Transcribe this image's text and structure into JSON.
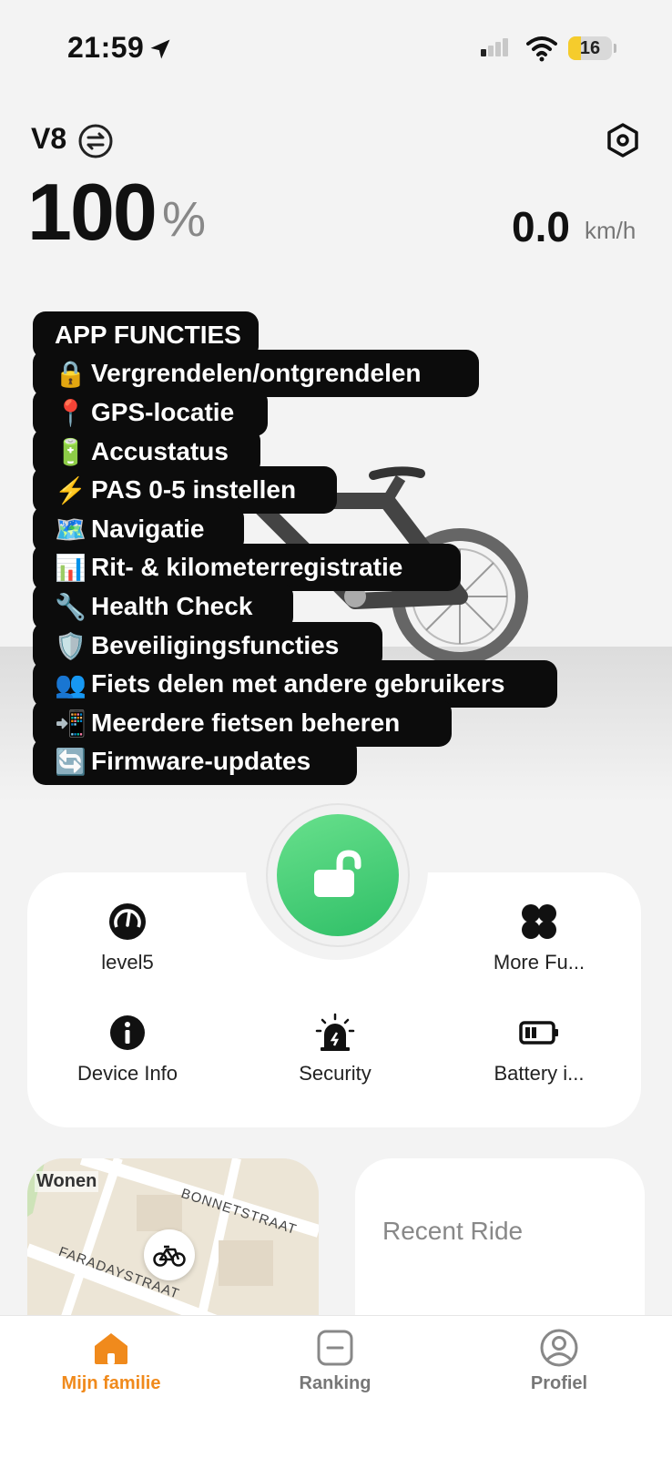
{
  "status_bar": {
    "time": "21:59",
    "battery_level": "16"
  },
  "header": {
    "device_name": "V8",
    "battery_value": "100",
    "battery_unit": "%",
    "speed_value": "0.0",
    "speed_unit": "km/h"
  },
  "overlay": {
    "title": "APP FUNCTIES",
    "items": [
      {
        "emoji": "🔒",
        "text": "Vergrendelen/ontgrendelen"
      },
      {
        "emoji": "📍",
        "text": "GPS-locatie"
      },
      {
        "emoji": "🔋",
        "text": "Accustatus"
      },
      {
        "emoji": "⚡",
        "text": "PAS 0-5 instellen"
      },
      {
        "emoji": "🗺️",
        "text": "Navigatie"
      },
      {
        "emoji": "📊",
        "text": "Rit- & kilometerregistratie"
      },
      {
        "emoji": "🔧",
        "text": "Health Check"
      },
      {
        "emoji": "🛡️",
        "text": "Beveiligingsfuncties"
      },
      {
        "emoji": "👥",
        "text": "Fiets delen met andere gebruikers"
      },
      {
        "emoji": "📲",
        "text": "Meerdere fietsen beheren"
      },
      {
        "emoji": "🔄",
        "text": "Firmware-updates"
      }
    ]
  },
  "controls": {
    "level": "level5",
    "more": "More Fu...",
    "device_info": "Device Info",
    "security": "Security",
    "battery": "Battery i..."
  },
  "map": {
    "label_area": "Wonen",
    "street_1": "BONNETSTRAAT",
    "street_2": "FARADAYSTRAAT"
  },
  "recent_ride": {
    "title": "Recent Ride"
  },
  "tabs": [
    {
      "label": "Mijn familie",
      "active": true
    },
    {
      "label": "Ranking",
      "active": false
    },
    {
      "label": "Profiel",
      "active": false
    }
  ],
  "colors": {
    "accent": "#f08a1c",
    "unlock_green": "#3ccc74",
    "overlay_bg": "#0c0c0c"
  }
}
